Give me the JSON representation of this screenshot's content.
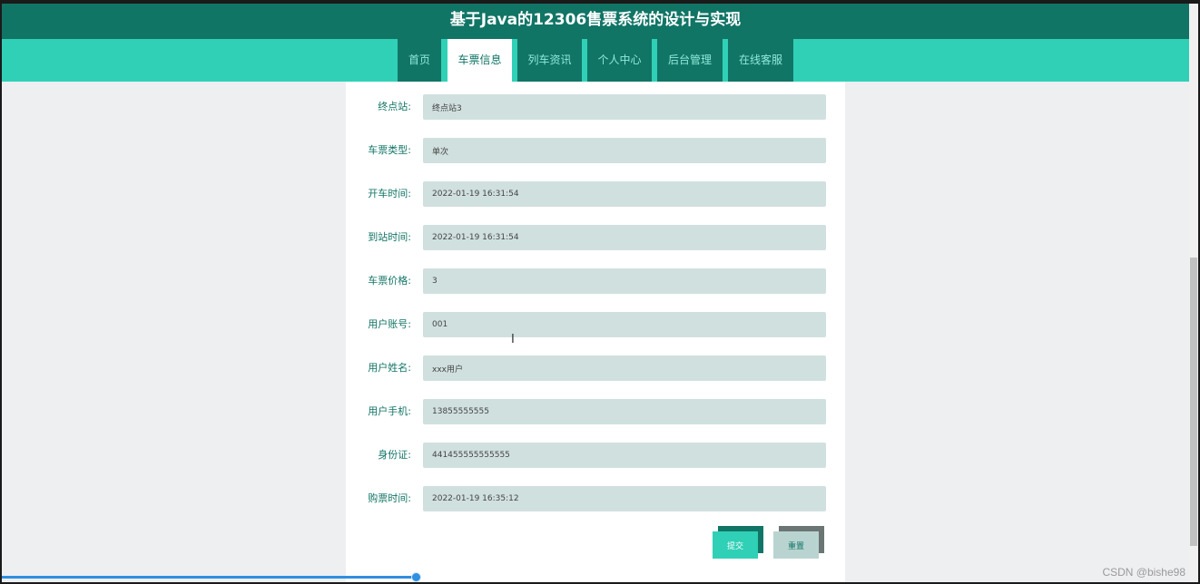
{
  "header": {
    "title": "基于Java的12306售票系统的设计与实现"
  },
  "nav": {
    "tabs": [
      {
        "label": "首页",
        "active": false
      },
      {
        "label": "车票信息",
        "active": true
      },
      {
        "label": "列车资讯",
        "active": false
      },
      {
        "label": "个人中心",
        "active": false
      },
      {
        "label": "后台管理",
        "active": false
      },
      {
        "label": "在线客服",
        "active": false
      }
    ]
  },
  "form": {
    "fields": [
      {
        "label": "终点站:",
        "value": "终点站3"
      },
      {
        "label": "车票类型:",
        "value": "单次"
      },
      {
        "label": "开车时间:",
        "value": "2022-01-19 16:31:54"
      },
      {
        "label": "到站时间:",
        "value": "2022-01-19 16:31:54"
      },
      {
        "label": "车票价格:",
        "value": "3"
      },
      {
        "label": "用户账号:",
        "value": "001"
      },
      {
        "label": "用户姓名:",
        "value": "xxx用户"
      },
      {
        "label": "用户手机:",
        "value": "13855555555"
      },
      {
        "label": "身份证:",
        "value": "441455555555555"
      },
      {
        "label": "购票时间:",
        "value": "2022-01-19 16:35:12"
      }
    ],
    "submit_label": "提交",
    "reset_label": "重置"
  },
  "colors": {
    "primary_dark": "#117566",
    "primary_light": "#30d0b6",
    "input_bg": "#d0e0df",
    "reset_bg": "#b9d4d0",
    "reset_shadow": "#6b7573"
  },
  "icons": {
    "cursor": "text-cursor-icon"
  },
  "watermark": "CSDN @bishe98"
}
